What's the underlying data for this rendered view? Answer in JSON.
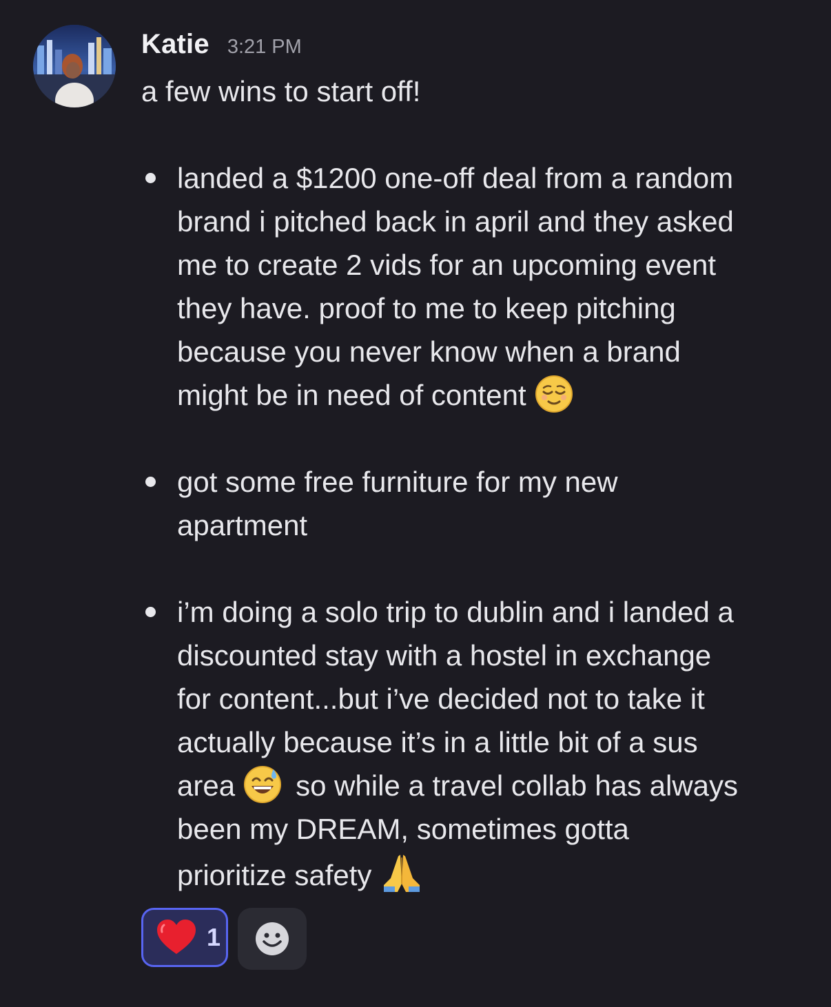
{
  "message": {
    "username": "Katie",
    "timestamp": "3:21 PM",
    "intro": "a few wins to start off!",
    "bullets": [
      {
        "lines": [
          "landed a $1200 one-off deal from a random",
          "brand i pitched back in april and they asked",
          "me to create 2 vids for an upcoming event",
          "they have. proof to me to keep pitching",
          "because  you never know when a brand",
          "might be in need of content"
        ],
        "emoji": "relieved-face"
      },
      {
        "lines": [
          "got some free furniture for my new",
          "apartment"
        ]
      },
      {
        "lines": [
          "i’m doing a solo trip to dublin and i landed a",
          "discounted stay with a hostel in exchange",
          "for content...but i’ve decided not to take it",
          "actually because it’s in a little bit of a sus",
          "area",
          "so while a travel collab has always",
          "been my DREAM, sometimes gotta",
          "prioritize safety"
        ],
        "emojis": [
          "grinning-face-with-sweat",
          "folded-hands"
        ]
      }
    ]
  },
  "reactions": {
    "heart": {
      "emoji": "red-heart",
      "count": "1"
    },
    "add_reaction_icon": "add-reaction-smiley-icon"
  },
  "colors": {
    "background": "#1c1b22",
    "text": "#e8e8ec",
    "timestamp": "#a2a2ab",
    "reaction_border": "#5865f2",
    "reaction_bg": "#2b2d5a"
  }
}
